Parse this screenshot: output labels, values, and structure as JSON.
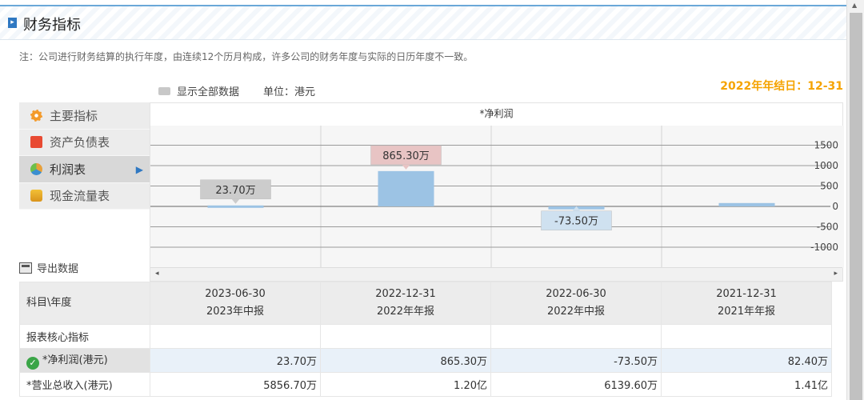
{
  "header": {
    "title": "财务指标",
    "icon": "arrow-right-icon"
  },
  "note": "注：公司进行财务结算的执行年度，由连续12个历月构成，许多公司的财务年度与实际的日历年度不一致。",
  "toolbar": {
    "show_all": "显示全部数据",
    "unit": "单位：港元"
  },
  "year_end": "2022年年结日：12-31",
  "menu": [
    {
      "label": "主要指标",
      "icon": "gear-icon"
    },
    {
      "label": "资产负债表",
      "icon": "document-icon"
    },
    {
      "label": "利润表",
      "icon": "pie-chart-icon",
      "active": true
    },
    {
      "label": "现金流量表",
      "icon": "coins-icon"
    }
  ],
  "export_label": "导出数据",
  "chart_data": {
    "type": "bar",
    "title": "*净利润",
    "categories": [
      "2023-06-30",
      "2022-12-31",
      "2022-06-30",
      "2021-12-31"
    ],
    "values": [
      23.7,
      865.3,
      -73.5,
      82.4
    ],
    "data_labels": [
      "23.70万",
      "865.30万",
      "-73.50万",
      ""
    ],
    "yticks": [
      1500,
      1000,
      500,
      0,
      -500,
      -1000
    ],
    "ylim": [
      -1000,
      1500
    ],
    "grid": true
  },
  "table": {
    "header_label": "科目\\年度",
    "periods": [
      {
        "date": "2023-06-30",
        "type": "2023年中报"
      },
      {
        "date": "2022-12-31",
        "type": "2022年年报"
      },
      {
        "date": "2022-06-30",
        "type": "2022年中报"
      },
      {
        "date": "2021-12-31",
        "type": "2021年年报"
      }
    ],
    "section_label": "报表核心指标",
    "rows": [
      {
        "label": "*净利润(港元)",
        "values": [
          "23.70万",
          "865.30万",
          "-73.50万",
          "82.40万"
        ]
      },
      {
        "label": "*营业总收入(港元)",
        "values": [
          "5856.70万",
          "1.20亿",
          "6139.60万",
          "1.41亿"
        ]
      }
    ]
  },
  "colors": {
    "bar": "#9cc3e4",
    "accent": "#2f78c2",
    "year_end": "#f5a300"
  }
}
